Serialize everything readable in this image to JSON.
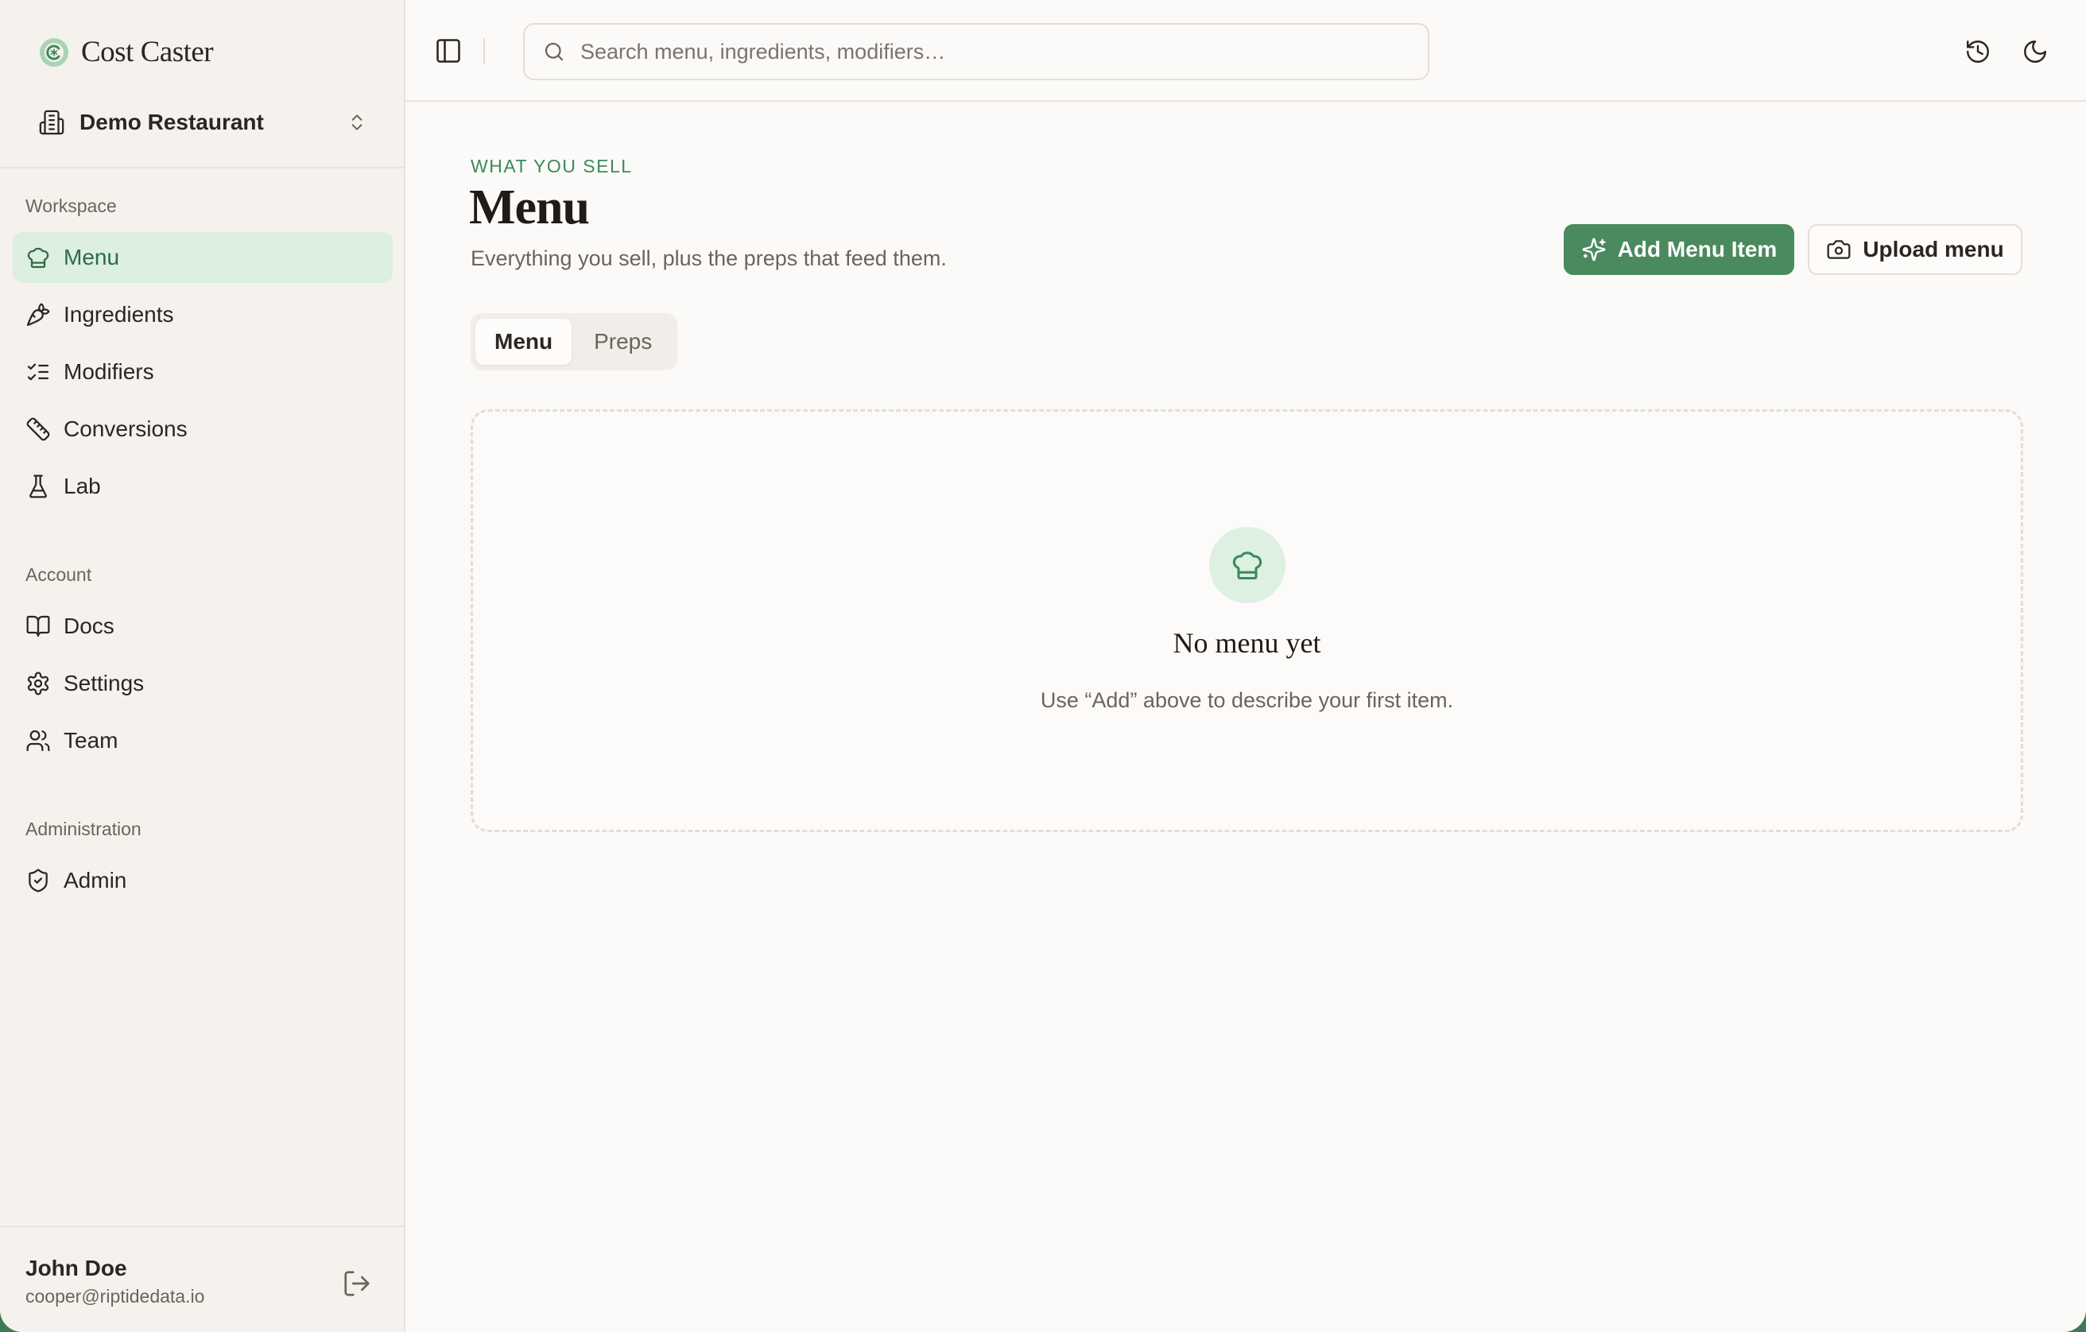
{
  "brand": {
    "name": "Cost Caster",
    "logo_icon": "cost-caster-logo-icon"
  },
  "org": {
    "name": "Demo Restaurant",
    "icon": "building-icon"
  },
  "sidebar": {
    "workspace_label": "Workspace",
    "workspace_items": [
      {
        "label": "Menu",
        "icon": "chef-hat-icon",
        "active": true
      },
      {
        "label": "Ingredients",
        "icon": "carrot-icon"
      },
      {
        "label": "Modifiers",
        "icon": "list-checks-icon"
      },
      {
        "label": "Conversions",
        "icon": "ruler-icon"
      },
      {
        "label": "Lab",
        "icon": "flask-icon"
      }
    ],
    "account_label": "Account",
    "account_items": [
      {
        "label": "Docs",
        "icon": "book-icon"
      },
      {
        "label": "Settings",
        "icon": "gear-icon"
      },
      {
        "label": "Team",
        "icon": "users-icon"
      }
    ],
    "admin_label": "Administration",
    "admin_items": [
      {
        "label": "Admin",
        "icon": "shield-check-icon"
      }
    ]
  },
  "user": {
    "name": "John Doe",
    "email": "cooper@riptidedata.io"
  },
  "search": {
    "placeholder": "Search menu, ingredients, modifiers…",
    "value": ""
  },
  "header": {
    "eyebrow": "WHAT YOU SELL",
    "title": "Menu",
    "subtitle": "Everything you sell, plus the preps that feed them."
  },
  "actions": {
    "add_label": "Add Menu Item",
    "upload_label": "Upload menu"
  },
  "tabs": [
    {
      "label": "Menu",
      "active": true
    },
    {
      "label": "Preps",
      "active": false
    }
  ],
  "empty_state": {
    "title": "No menu yet",
    "text": "Use “Add” above to describe your first item.",
    "icon": "chef-hat-icon"
  },
  "colors": {
    "accent": "#4a8a5e",
    "accent_text": "#2d6b45",
    "active_bg": "#dcefe0",
    "sidebar_bg": "#f5f2ee",
    "page_bg": "#fbfaf8"
  }
}
